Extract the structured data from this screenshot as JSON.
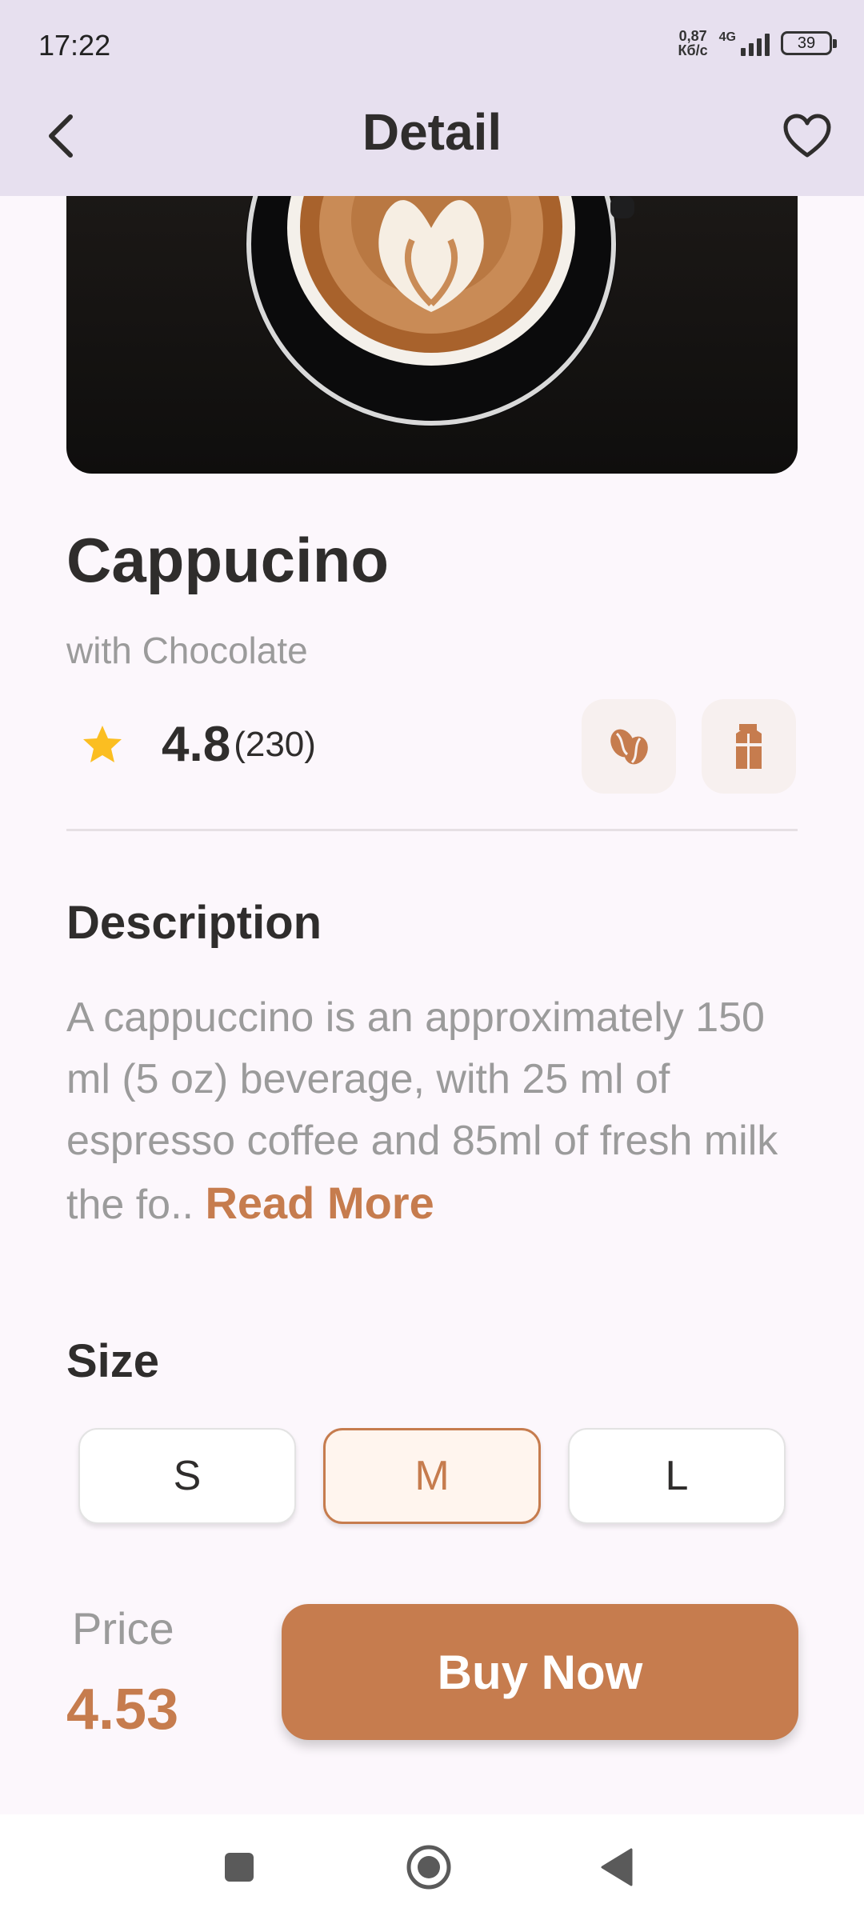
{
  "status_bar": {
    "time": "17:22",
    "net_speed_value": "0,87",
    "net_speed_unit": "Кб/с",
    "network": "4G",
    "battery": "39"
  },
  "header": {
    "title": "Detail"
  },
  "product": {
    "name": "Cappucino",
    "subtitle": "with Chocolate",
    "rating": "4.8",
    "rating_count": "(230)",
    "features": [
      "coffee-beans-icon",
      "milk-carton-icon"
    ]
  },
  "description": {
    "title": "Description",
    "text": "A cappuccino is an approximately 150 ml (5 oz) beverage, with 25 ml of espresso coffee and 85ml of fresh milk the fo..",
    "read_more": "Read More"
  },
  "size": {
    "title": "Size",
    "options": [
      "S",
      "M",
      "L"
    ],
    "selected": "M"
  },
  "checkout": {
    "price_label": "Price",
    "price": "4.53",
    "buy_label": "Buy Now"
  },
  "colors": {
    "accent": "#C67C4E",
    "app_bar": "#E7E0EF",
    "background": "#FCF7FC",
    "text_primary": "#2F2D2C",
    "text_secondary": "#9B9B9B",
    "star": "#FBBE21"
  }
}
